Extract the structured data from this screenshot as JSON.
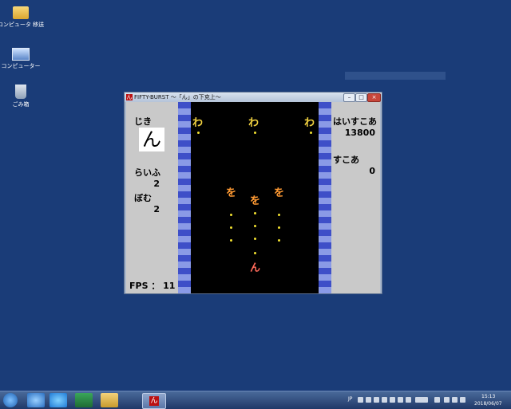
{
  "desktop": {
    "icons": [
      {
        "label": "コンピュータ 移送",
        "icon": "folder-icon"
      },
      {
        "label": "コンピューター",
        "icon": "computer-icon"
      },
      {
        "label": "ごみ箱",
        "icon": "recycle-bin-icon"
      }
    ]
  },
  "window": {
    "title": "FIFTY-BURST ～「ん」の下克上～",
    "logo": "ん",
    "controls": {
      "minimize": "–",
      "maximize": "□",
      "close": "×"
    }
  },
  "game": {
    "left_panel": {
      "jiki_label": "じき",
      "jiki_char": "ん",
      "life_label": "らいふ",
      "life_value": "2",
      "bomb_label": "ぼむ",
      "bomb_value": "2",
      "fps_label": "FPS ： 11"
    },
    "right_panel": {
      "hiscore_label": "はいすこあ",
      "hiscore_value": "13800",
      "score_label": "すこあ",
      "score_value": "0"
    },
    "enemies": [
      {
        "char": "わ",
        "kind": "wa"
      },
      {
        "char": "わ",
        "kind": "wa"
      },
      {
        "char": "わ",
        "kind": "wa"
      },
      {
        "char": "を",
        "kind": "wo"
      },
      {
        "char": "を",
        "kind": "wo"
      },
      {
        "char": "を",
        "kind": "wo"
      }
    ],
    "player_char": "ん",
    "colors": {
      "stripe_dark": "#3e4fc8",
      "stripe_light": "#8a9ae6",
      "bullet": "#f2e030",
      "field": "#000000"
    }
  },
  "taskbar": {
    "ime": "JP",
    "time": "15:13",
    "date": "2018/06/07"
  }
}
